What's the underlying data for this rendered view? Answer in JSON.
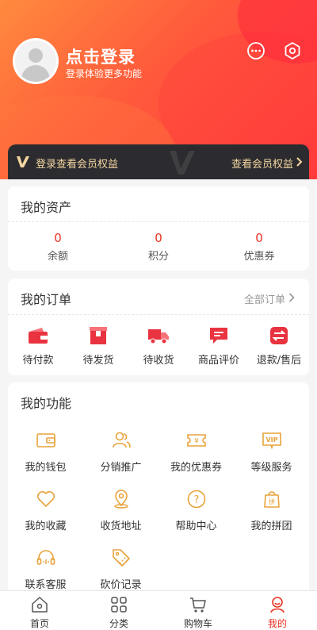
{
  "header": {
    "title": "点击登录",
    "subtitle": "登录体验更多功能",
    "icons": [
      "message-icon",
      "settings-icon"
    ]
  },
  "vip": {
    "left_text": "登录查看会员权益",
    "right_text": "查看会员权益"
  },
  "assets": {
    "title": "我的资产",
    "items": [
      {
        "value": "0",
        "label": "余额"
      },
      {
        "value": "0",
        "label": "积分"
      },
      {
        "value": "0",
        "label": "优惠券"
      }
    ]
  },
  "orders": {
    "title": "我的订单",
    "all_label": "全部订单",
    "items": [
      {
        "label": "待付款",
        "icon": "wallet-icon"
      },
      {
        "label": "待发货",
        "icon": "package-icon"
      },
      {
        "label": "待收货",
        "icon": "truck-icon"
      },
      {
        "label": "商品评价",
        "icon": "comment-icon"
      },
      {
        "label": "退款/售后",
        "icon": "refund-icon"
      }
    ]
  },
  "functions": {
    "title": "我的功能",
    "items": [
      {
        "label": "我的钱包",
        "icon": "wallet-icon"
      },
      {
        "label": "分销推广",
        "icon": "users-icon"
      },
      {
        "label": "我的优惠券",
        "icon": "coupon-icon"
      },
      {
        "label": "等级服务",
        "icon": "vip-icon"
      },
      {
        "label": "我的收藏",
        "icon": "heart-icon"
      },
      {
        "label": "收货地址",
        "icon": "location-icon"
      },
      {
        "label": "帮助中心",
        "icon": "help-icon"
      },
      {
        "label": "我的拼团",
        "icon": "group-buy-icon"
      },
      {
        "label": "联系客服",
        "icon": "headset-icon"
      },
      {
        "label": "砍价记录",
        "icon": "bargain-icon"
      }
    ]
  },
  "tabbar": {
    "items": [
      {
        "label": "首页",
        "icon": "home-icon"
      },
      {
        "label": "分类",
        "icon": "category-icon"
      },
      {
        "label": "购物车",
        "icon": "cart-icon"
      },
      {
        "label": "我的",
        "icon": "profile-icon"
      }
    ],
    "active": "我的"
  },
  "colors": {
    "accent": "#e93323",
    "header_from": "#ff8a3d",
    "header_to": "#ff3b3b",
    "vip_bar": "#2c2c30",
    "vip_text": "#f4d6a0",
    "function_icon": "#e8a33a"
  }
}
